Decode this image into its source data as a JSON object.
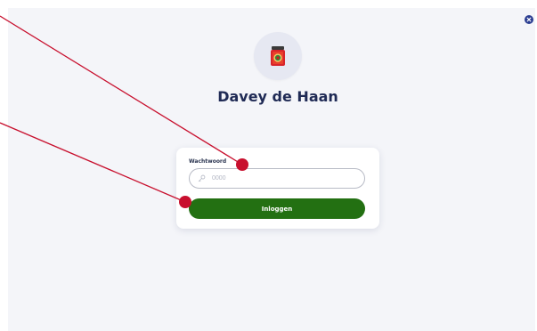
{
  "profile": {
    "name": "Davey de Haan",
    "avatar_icon": "jar-icon"
  },
  "login": {
    "password_label": "Wachtwoord",
    "password_placeholder": "0000",
    "password_value": "",
    "submit_label": "Inloggen"
  },
  "header": {
    "close_icon": "close-icon"
  },
  "colors": {
    "background": "#f4f5f9",
    "title": "#1f2a55",
    "primary_button": "#237012",
    "close_button": "#2a3d91",
    "annotation": "#c8102e"
  }
}
